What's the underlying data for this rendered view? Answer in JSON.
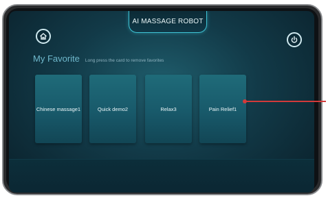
{
  "header": {
    "title": "AI MASSAGE ROBOT"
  },
  "icons": {
    "home": "home-icon",
    "power": "power-icon"
  },
  "favorites": {
    "title": "My Favorite",
    "hint": "Long press the card to remove favorites",
    "cards": [
      {
        "label": "Chinese massage1"
      },
      {
        "label": "Quick demo2"
      },
      {
        "label": "Relax3"
      },
      {
        "label": "Pain Relief1"
      }
    ]
  },
  "colors": {
    "accent": "#3fc5d6",
    "card": "#1f6b79",
    "callout": "#d33a3a"
  }
}
